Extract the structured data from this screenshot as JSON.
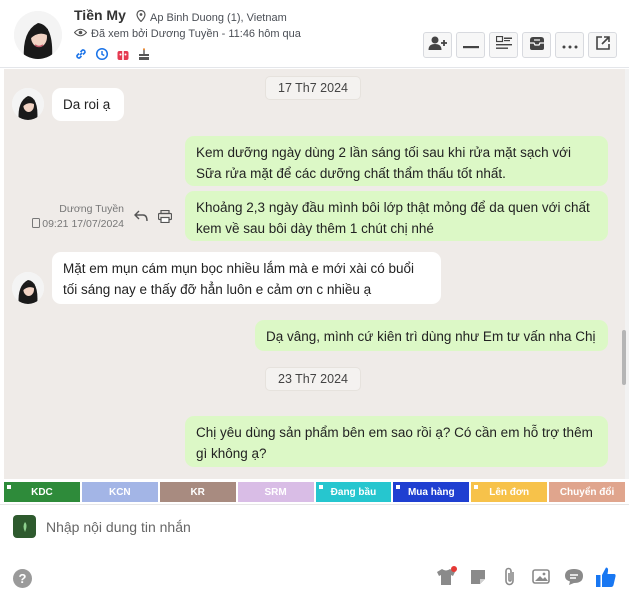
{
  "header": {
    "name": "Tiền My",
    "location": "Ap Binh Duong (1), Vietnam",
    "seen": "Đã xem bởi Dương Tuyền - 11:46 hôm qua"
  },
  "messages": {
    "date1": "17 Th7 2024",
    "date2": "23 Th7 2024",
    "m1": "Da roi ạ",
    "m2": "Kem dưỡng ngày dùng 2 lần sáng tối sau khi rửa mặt sạch với Sữa rửa mặt để các dưỡng chất thẩm thấu tốt nhất.",
    "m3": "Khoảng 2,3 ngày đầu mình bôi lớp thật mỏng để da quen với chất kem về sau bôi dày thêm 1 chút chị nhé",
    "sender": "Dương Tuyền",
    "sender_time": "09:21 17/07/2024",
    "m4": "Mặt em mụn cám mụn bọc nhiều lắm mà e mới xài có buổi tối sáng nay e thấy đỡ hẳn luôn e cảm ơn c nhiều ạ",
    "m5": "Dạ vâng, mình cứ kiên trì dùng như Em tư vấn nha Chị",
    "m6": "Chị yêu dùng sản phẩm bên em sao rồi ạ? Có cần em hỗ trợ thêm gì không ạ?"
  },
  "tags": [
    {
      "label": "KDC",
      "color": "#2e8b3a"
    },
    {
      "label": "KCN",
      "color": "#a3b5e6"
    },
    {
      "label": "KR",
      "color": "#a88b80"
    },
    {
      "label": "SRM",
      "color": "#d9bde6"
    },
    {
      "label": "Đang bầu",
      "color": "#26c6cf"
    },
    {
      "label": "Mua hàng",
      "color": "#1f3fd1"
    },
    {
      "label": "Lên đơn",
      "color": "#f7c24a"
    },
    {
      "label": "Chuyển đổi",
      "color": "#e0a58d"
    }
  ],
  "composer": {
    "placeholder": "Nhập nội dung tin nhắn"
  },
  "icons": [
    "location-pin-icon",
    "eye-icon",
    "link-icon",
    "history-icon",
    "gift-icon",
    "cake-icon",
    "add-user-icon",
    "minimize-icon",
    "details-icon",
    "inbox-icon",
    "more-icon",
    "open-external-icon",
    "reply-icon",
    "print-icon",
    "help-icon",
    "tshirt-icon",
    "sticker-icon",
    "attach-icon",
    "image-icon",
    "quick-reply-icon",
    "like-icon"
  ]
}
